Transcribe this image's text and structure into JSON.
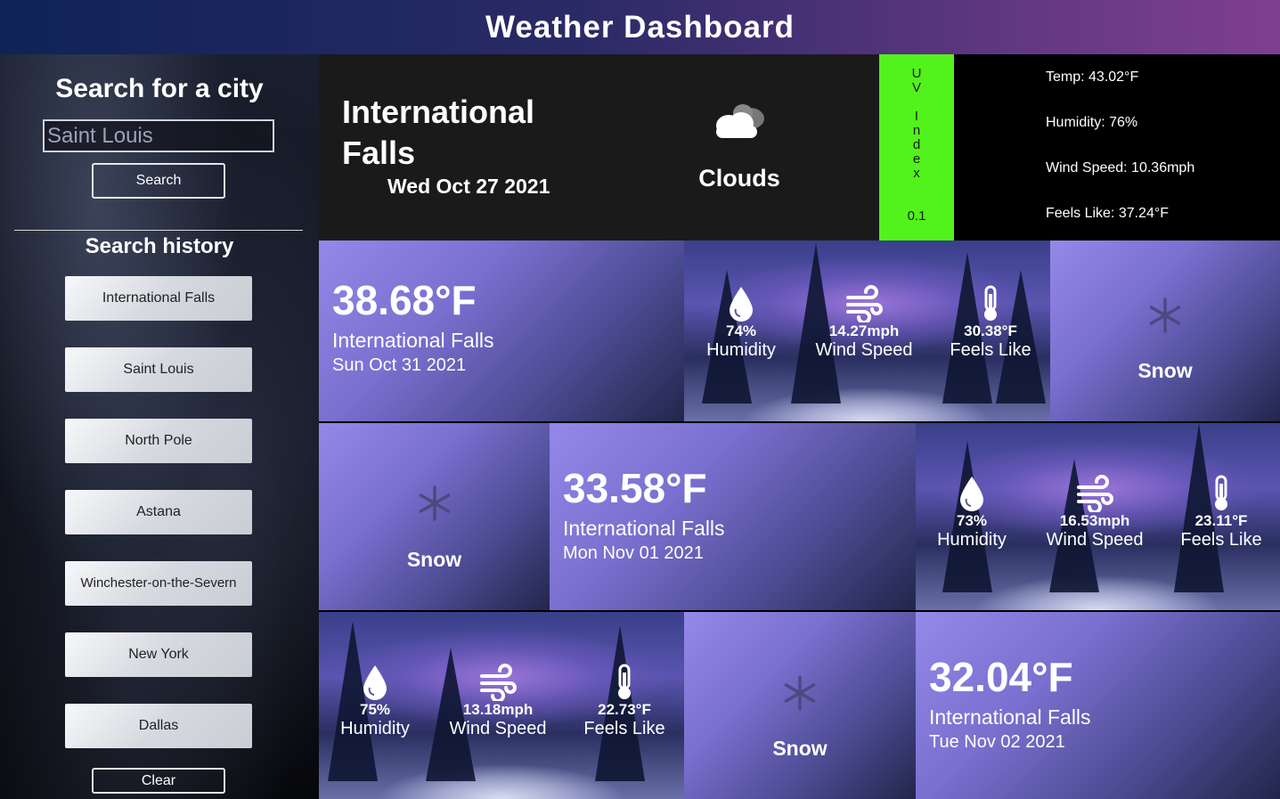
{
  "header": {
    "title": "Weather Dashboard"
  },
  "sidebar": {
    "search_title": "Search for a city",
    "search_value": "Saint Louis",
    "search_button": "Search",
    "history_title": "Search history",
    "history": [
      "International Falls",
      "Saint Louis",
      "North Pole",
      "Astana",
      "Winchester-on-the-Severn",
      "New York",
      "Dallas"
    ],
    "clear_button": "Clear"
  },
  "current": {
    "city": "International Falls",
    "date": "Wed Oct 27 2021",
    "condition": "Clouds",
    "condition_icon": "cloud-icon",
    "uv_label": "UV Index",
    "uv_value": "0.1",
    "uv_color": "#52f21c",
    "temp": "Temp: 43.02°F",
    "humidity": "Humidity: 76%",
    "wind": "Wind Speed: 10.36mph",
    "feels_like": "Feels Like: 37.24°F"
  },
  "forecast": [
    {
      "temp": "38.68°F",
      "city": "International Falls",
      "date": "Sun Oct 31 2021",
      "humidity": "74%",
      "wind": "14.27mph",
      "feels": "30.38°F",
      "condition": "Snow"
    },
    {
      "temp": "33.58°F",
      "city": "International Falls",
      "date": "Mon Nov 01 2021",
      "humidity": "73%",
      "wind": "16.53mph",
      "feels": "23.11°F",
      "condition": "Snow"
    },
    {
      "temp": "32.04°F",
      "city": "International Falls",
      "date": "Tue Nov 02 2021",
      "humidity": "75%",
      "wind": "13.18mph",
      "feels": "22.73°F",
      "condition": "Snow"
    }
  ],
  "labels": {
    "humidity": "Humidity",
    "wind": "Wind Speed",
    "feels": "Feels Like"
  }
}
